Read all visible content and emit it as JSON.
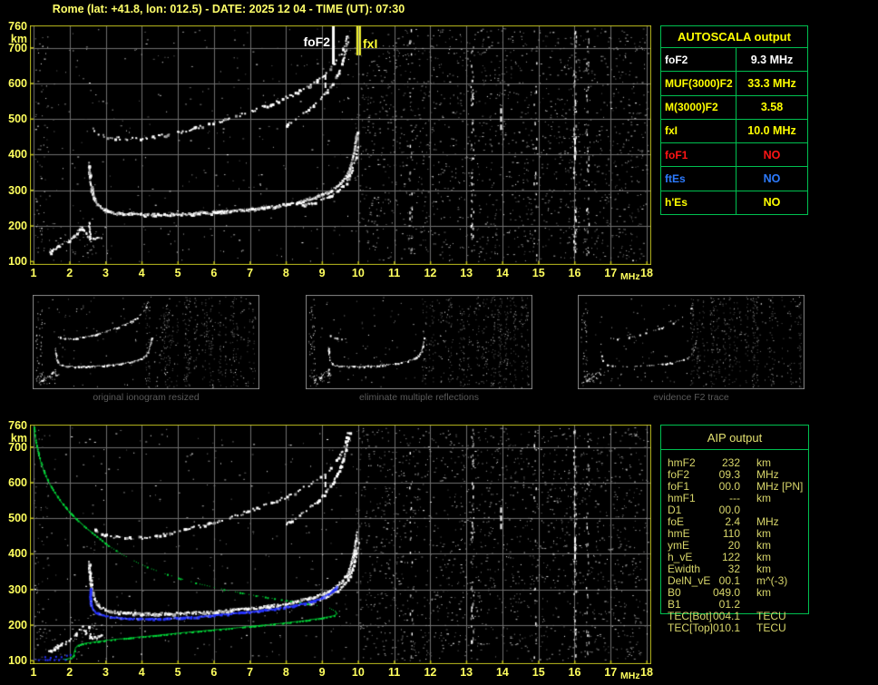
{
  "title": "Rome (lat: +41.8, lon: 012.5) - DATE: 2025 12 04 - TIME (UT): 07:30",
  "colors": {
    "axis_yellow": "#ffff5e",
    "table_yellow": "#ffff00",
    "green_border": "#00c050",
    "aip_text": "#d8d66a",
    "red": "#ff1515",
    "blue": "#2d7bff",
    "profile_green": "#00d839",
    "trace_blue": "#2633ff",
    "frame_yellow": "#bcbc1e",
    "grid_gray": "#6f6f6f",
    "caption_gray": "#5a5a5a",
    "trace_white": "#ffffff"
  },
  "axes": {
    "x_ticks": [
      "1",
      "2",
      "3",
      "4",
      "5",
      "6",
      "7",
      "8",
      "9",
      "10",
      "11",
      "12",
      "13",
      "14",
      "15",
      "16",
      "17",
      "18"
    ],
    "x_unit": "MHz",
    "y_tick_values": [
      760,
      700,
      600,
      500,
      400,
      300,
      200,
      100
    ],
    "y_tick_labels": [
      "760",
      "700",
      "600",
      "500",
      "400",
      "300",
      "200",
      "100"
    ],
    "y_unit": "km"
  },
  "top_chart": {
    "foF2_label": "foF2",
    "fxI_label": "fxI"
  },
  "autoscala": {
    "title": "AUTOSCALA output",
    "rows": [
      {
        "label": "foF2",
        "value": "9.3 MHz",
        "color": "#ffffff"
      },
      {
        "label": "MUF(3000)F2",
        "value": "33.3 MHz",
        "color": "#ffff00"
      },
      {
        "label": "M(3000)F2",
        "value": "3.58",
        "color": "#ffff00"
      },
      {
        "label": "fxI",
        "value": "10.0 MHz",
        "color": "#ffff00"
      },
      {
        "label": "foF1",
        "value": "NO",
        "color": "#ff1515"
      },
      {
        "label": "ftEs",
        "value": "NO",
        "color": "#2d7bff"
      },
      {
        "label": "h'Es",
        "value": "NO",
        "color": "#ffff00"
      }
    ]
  },
  "thumbnails": [
    {
      "caption": "original ionogram resized",
      "mode": "full"
    },
    {
      "caption": "eliminate multiple reflections",
      "mode": "nomult"
    },
    {
      "caption": "evidence F2 trace",
      "mode": "f2only"
    }
  ],
  "aip": {
    "title": "AIP output",
    "rows": [
      {
        "label": "hmF2",
        "value": "232",
        "unit": "km",
        "note": ""
      },
      {
        "label": "foF2",
        "value": "09.3",
        "unit": "MHz",
        "note": ""
      },
      {
        "label": "foF1",
        "value": "00.0",
        "unit": "MHz",
        "note": "[PN]"
      },
      {
        "label": "hmF1",
        "value": "---",
        "unit": "km",
        "note": ""
      },
      {
        "label": "D1",
        "value": "00.0",
        "unit": "",
        "note": ""
      },
      {
        "label": "foE",
        "value": "2.4",
        "unit": "MHz",
        "note": ""
      },
      {
        "label": "hmE",
        "value": "110",
        "unit": "km",
        "note": ""
      },
      {
        "label": "ymE",
        "value": "20",
        "unit": "km",
        "note": ""
      },
      {
        "label": "h_vE",
        "value": "122",
        "unit": "km",
        "note": ""
      },
      {
        "label": "Ewidth",
        "value": "32",
        "unit": "km",
        "note": ""
      },
      {
        "label": "DelN_vE",
        "value": "00.1",
        "unit": "m^(-3)",
        "note": ""
      },
      {
        "label": "B0",
        "value": "049.0",
        "unit": "km",
        "note": ""
      },
      {
        "label": "B1",
        "value": "01.2",
        "unit": "",
        "note": ""
      },
      {
        "label": "TEC[Bot]",
        "value": "004.1",
        "unit": "TECU",
        "note": ""
      },
      {
        "label": "TEC[Top]",
        "value": "010.1",
        "unit": "TECU",
        "note": ""
      }
    ]
  },
  "chart_data": {
    "type": "scatter",
    "title": "ionogram virtual height vs frequency",
    "x_range_mhz": [
      1,
      18
    ],
    "y_range_km": [
      100,
      760
    ],
    "x_unit": "MHz",
    "y_unit": "km",
    "grid": true,
    "markers": {
      "foF2_mhz": 9.3,
      "fxI_mhz": 10.0
    },
    "noise_columns_mhz": [
      13.15,
      16.0,
      16.35,
      11.45,
      14.9
    ],
    "noise_column_counts": [
      55,
      85,
      40,
      22,
      22
    ],
    "traces": {
      "f2_hop1": [
        [
          2.52,
          378
        ],
        [
          2.53,
          352
        ],
        [
          2.56,
          322
        ],
        [
          2.6,
          298
        ],
        [
          2.66,
          278
        ],
        [
          2.74,
          262
        ],
        [
          2.86,
          250
        ],
        [
          3.02,
          243
        ],
        [
          3.25,
          238
        ],
        [
          3.6,
          235
        ],
        [
          4.0,
          233
        ],
        [
          4.5,
          233
        ],
        [
          5.0,
          234
        ],
        [
          5.5,
          236
        ],
        [
          6.0,
          239
        ],
        [
          6.5,
          243
        ],
        [
          7.0,
          248
        ],
        [
          7.5,
          254
        ],
        [
          8.0,
          262
        ],
        [
          8.4,
          270
        ],
        [
          8.8,
          281
        ],
        [
          9.1,
          293
        ],
        [
          9.35,
          308
        ],
        [
          9.55,
          326
        ],
        [
          9.7,
          349
        ],
        [
          9.8,
          378
        ],
        [
          9.87,
          410
        ],
        [
          9.92,
          442
        ],
        [
          9.95,
          465
        ]
      ],
      "f2_hop1_x": [
        [
          8.45,
          259
        ],
        [
          8.75,
          267
        ],
        [
          9.05,
          277
        ],
        [
          9.3,
          290
        ],
        [
          9.5,
          306
        ],
        [
          9.67,
          326
        ],
        [
          9.8,
          352
        ],
        [
          9.89,
          382
        ],
        [
          9.95,
          412
        ],
        [
          9.99,
          438
        ]
      ],
      "f2_hop2": [
        [
          2.62,
          478
        ],
        [
          2.72,
          464
        ],
        [
          2.9,
          455
        ],
        [
          3.15,
          449
        ],
        [
          3.5,
          446
        ],
        [
          3.9,
          447
        ],
        [
          4.3,
          451
        ],
        [
          4.7,
          458
        ],
        [
          5.2,
          469
        ],
        [
          5.7,
          482
        ],
        [
          6.2,
          497
        ],
        [
          6.7,
          513
        ],
        [
          7.2,
          530
        ],
        [
          7.7,
          549
        ],
        [
          8.2,
          571
        ],
        [
          8.6,
          594
        ],
        [
          9.0,
          622
        ],
        [
          9.3,
          652
        ],
        [
          9.5,
          682
        ],
        [
          9.62,
          712
        ],
        [
          9.7,
          742
        ]
      ],
      "f2_hop2_x": [
        [
          7.95,
          482
        ],
        [
          8.3,
          506
        ],
        [
          8.65,
          533
        ],
        [
          9.0,
          565
        ],
        [
          9.25,
          598
        ],
        [
          9.45,
          635
        ],
        [
          9.58,
          672
        ],
        [
          9.68,
          710
        ],
        [
          9.76,
          748
        ]
      ],
      "e_region": [
        [
          1.42,
          126
        ],
        [
          1.52,
          132
        ],
        [
          1.62,
          141
        ],
        [
          1.74,
          147
        ],
        [
          1.86,
          150
        ],
        [
          1.96,
          156
        ],
        [
          2.06,
          167
        ],
        [
          2.16,
          179
        ],
        [
          2.26,
          190
        ],
        [
          2.34,
          197
        ],
        [
          2.42,
          182
        ],
        [
          2.5,
          170
        ],
        [
          2.62,
          166
        ],
        [
          2.76,
          169
        ],
        [
          2.9,
          171
        ]
      ],
      "cusp": [
        [
          2.52,
          212
        ],
        [
          2.54,
          178
        ],
        [
          2.56,
          158
        ]
      ]
    },
    "profile_green": {
      "upper_solid": [
        [
          1.0,
          757
        ],
        [
          1.02,
          738
        ],
        [
          1.06,
          712
        ],
        [
          1.12,
          684
        ],
        [
          1.2,
          655
        ],
        [
          1.3,
          626
        ],
        [
          1.43,
          598
        ],
        [
          1.58,
          572
        ],
        [
          1.76,
          546
        ],
        [
          1.98,
          519
        ],
        [
          2.22,
          494
        ],
        [
          2.5,
          469
        ],
        [
          2.8,
          445
        ],
        [
          3.1,
          421
        ]
      ],
      "middle_dotted": [
        [
          3.1,
          421
        ],
        [
          3.5,
          396
        ],
        [
          3.95,
          372
        ],
        [
          4.45,
          351
        ],
        [
          5.0,
          333
        ],
        [
          5.6,
          316
        ],
        [
          6.2,
          302
        ],
        [
          6.9,
          288
        ],
        [
          7.6,
          276
        ],
        [
          8.3,
          265
        ],
        [
          8.85,
          256
        ],
        [
          9.2,
          248
        ],
        [
          9.35,
          240
        ]
      ],
      "lower_solid": [
        [
          9.35,
          240
        ],
        [
          9.4,
          233
        ],
        [
          9.32,
          227
        ],
        [
          9.0,
          221
        ],
        [
          8.5,
          213
        ],
        [
          7.8,
          205
        ],
        [
          7.0,
          197
        ],
        [
          6.2,
          189
        ],
        [
          5.4,
          182
        ],
        [
          4.6,
          174
        ],
        [
          3.8,
          166
        ],
        [
          3.1,
          159
        ],
        [
          2.65,
          153
        ],
        [
          2.38,
          149
        ],
        [
          2.22,
          144
        ],
        [
          2.15,
          136
        ],
        [
          2.12,
          126
        ],
        [
          2.1,
          116
        ],
        [
          2.05,
          109
        ],
        [
          1.95,
          106
        ],
        [
          1.8,
          104
        ]
      ]
    },
    "restored_trace_blue": {
      "main": [
        [
          2.56,
          302
        ],
        [
          2.55,
          282
        ],
        [
          2.56,
          262
        ],
        [
          2.62,
          246
        ],
        [
          2.72,
          236
        ],
        [
          2.88,
          229
        ],
        [
          3.1,
          224
        ],
        [
          3.4,
          221
        ],
        [
          3.8,
          219
        ],
        [
          4.3,
          219
        ],
        [
          4.8,
          221
        ],
        [
          5.4,
          224
        ],
        [
          6.0,
          229
        ],
        [
          6.6,
          235
        ],
        [
          7.2,
          241
        ],
        [
          7.8,
          249
        ],
        [
          8.3,
          258
        ],
        [
          8.7,
          268
        ],
        [
          9.0,
          279
        ],
        [
          9.2,
          291
        ],
        [
          9.33,
          303
        ],
        [
          9.4,
          313
        ]
      ],
      "bottom_line": [
        [
          1.0,
          104
        ],
        [
          2.05,
          104
        ]
      ],
      "e_dots": [
        [
          1.3,
          112
        ],
        [
          1.45,
          110
        ],
        [
          1.6,
          113
        ],
        [
          1.75,
          112
        ],
        [
          1.9,
          116
        ],
        [
          2.0,
          118
        ]
      ]
    }
  }
}
